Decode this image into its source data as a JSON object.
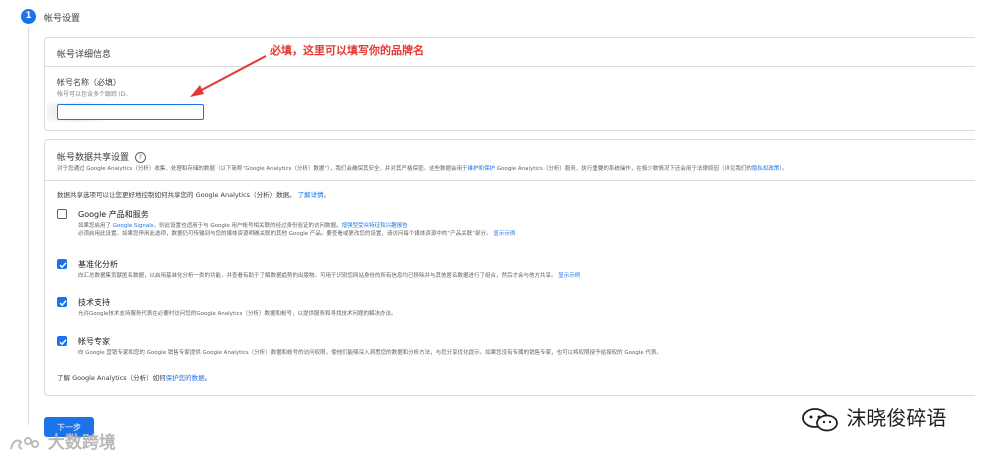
{
  "step": {
    "number": "1",
    "title": "帐号设置"
  },
  "account_details": {
    "heading": "帐号详细信息",
    "name_label": "帐号名称（必填）",
    "name_hint": "帐号可以包含多个跟踪 ID。",
    "name_value": ""
  },
  "annotation": {
    "text": "必填，这里可以填写你的品牌名",
    "color": "#e53935"
  },
  "data_sharing": {
    "heading": "帐号数据共享设置",
    "help_icon": "?",
    "description_pre": "对于您通过 Google Analytics（分析）收集、处理和存储的数据（以下简称“Google Analytics（分析）数据”），我们会确保其安全，并对其严格保密。这些数据会用于",
    "description_link1": "维护和保护",
    "description_mid": " Google Analytics（分析）服务、执行重要的系统操作，在极少数情况下还会用于法律原因（详见我们的",
    "description_link2": "隐私权政策",
    "description_post": "）。",
    "intro": "数据共享选项可以让您更好地控制如何共享您的 Google Analytics（分析）数据。",
    "intro_link": "了解详情。",
    "options": [
      {
        "title": "Google 产品和服务",
        "checked": false,
        "desc_pre": "如果您启用了 ",
        "desc_link": "Google Signals",
        "desc_post": "，则此设置也适用于与 Google 用户帐号相关联的经过身份验证的访问数据。",
        "desc_link2": "增强型受众特征和兴趣报告",
        "desc_post2": "必须启用此设置。如果您停用此选项，数据仍可传输到与您的媒体资源明确关联的其他 Google 产品。要查看或更改您的设置，请访问每个媒体资源中的“产品关联”部分。",
        "example": "显示示例"
      },
      {
        "title": "基准化分析",
        "checked": true,
        "desc_pre": "向汇总数据集贡献匿名数据，以启用基准化分析一类的功能，并查看有助于了解数据趋势的出版物。可用于识别您网站身份的所有信息均已移除并与其他匿名数据进行了组合，然后才会与他方共享。",
        "example": "显示示例"
      },
      {
        "title": "技术支持",
        "checked": true,
        "desc_pre": "允许Google技术支持服务代表在必要时访问您的Google Analytics（分析）数据和帐号，以提供服务和寻找技术问题的解决办法。"
      },
      {
        "title": "帐号专家",
        "checked": true,
        "desc_pre": "向 Google 营销专家和您的 Google 销售专家提供 Google Analytics（分析）数据和帐号的访问权限，使他们能够深入洞悉您的数据和分析方法，与您分享优化提示。如果您没有专属的销售专家，也可以将权限授予给授权的 Google 代表。"
      }
    ],
    "footer_pre": "了解 Google Analytics（分析）如何",
    "footer_link": "保护您的数据",
    "footer_post": "。"
  },
  "next_button": {
    "label": "下一步"
  },
  "watermarks": {
    "left": "大数跨境",
    "right": "沫晓俊碎语"
  },
  "colors": {
    "accent": "#1a73e8",
    "annotation": "#e53935"
  }
}
